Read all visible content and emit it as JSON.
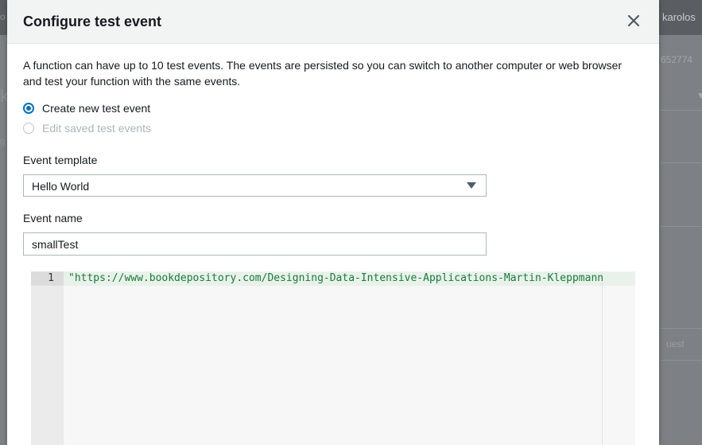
{
  "background": {
    "user_name": "karolos",
    "account_fragment": "652774",
    "request_fragment": "uest"
  },
  "modal": {
    "title": "Configure test event",
    "close_icon": "close-icon",
    "intro": "A function can have up to 10 test events. The events are persisted so you can switch to another computer or web browser and test your function with the same events.",
    "options": [
      {
        "label": "Create new test event",
        "selected": true,
        "disabled": false
      },
      {
        "label": "Edit saved test events",
        "selected": false,
        "disabled": true
      }
    ],
    "event_template": {
      "label": "Event template",
      "value": "Hello World"
    },
    "event_name": {
      "label": "Event name",
      "value": "smallTest"
    },
    "editor": {
      "lines": [
        {
          "number": "1",
          "text": "\"https://www.bookdepository.com/Designing-Data-Intensive-Applications-Martin-Kleppmann"
        }
      ]
    }
  },
  "colors": {
    "accent": "#0073bb",
    "string": "#1a7a3a"
  }
}
